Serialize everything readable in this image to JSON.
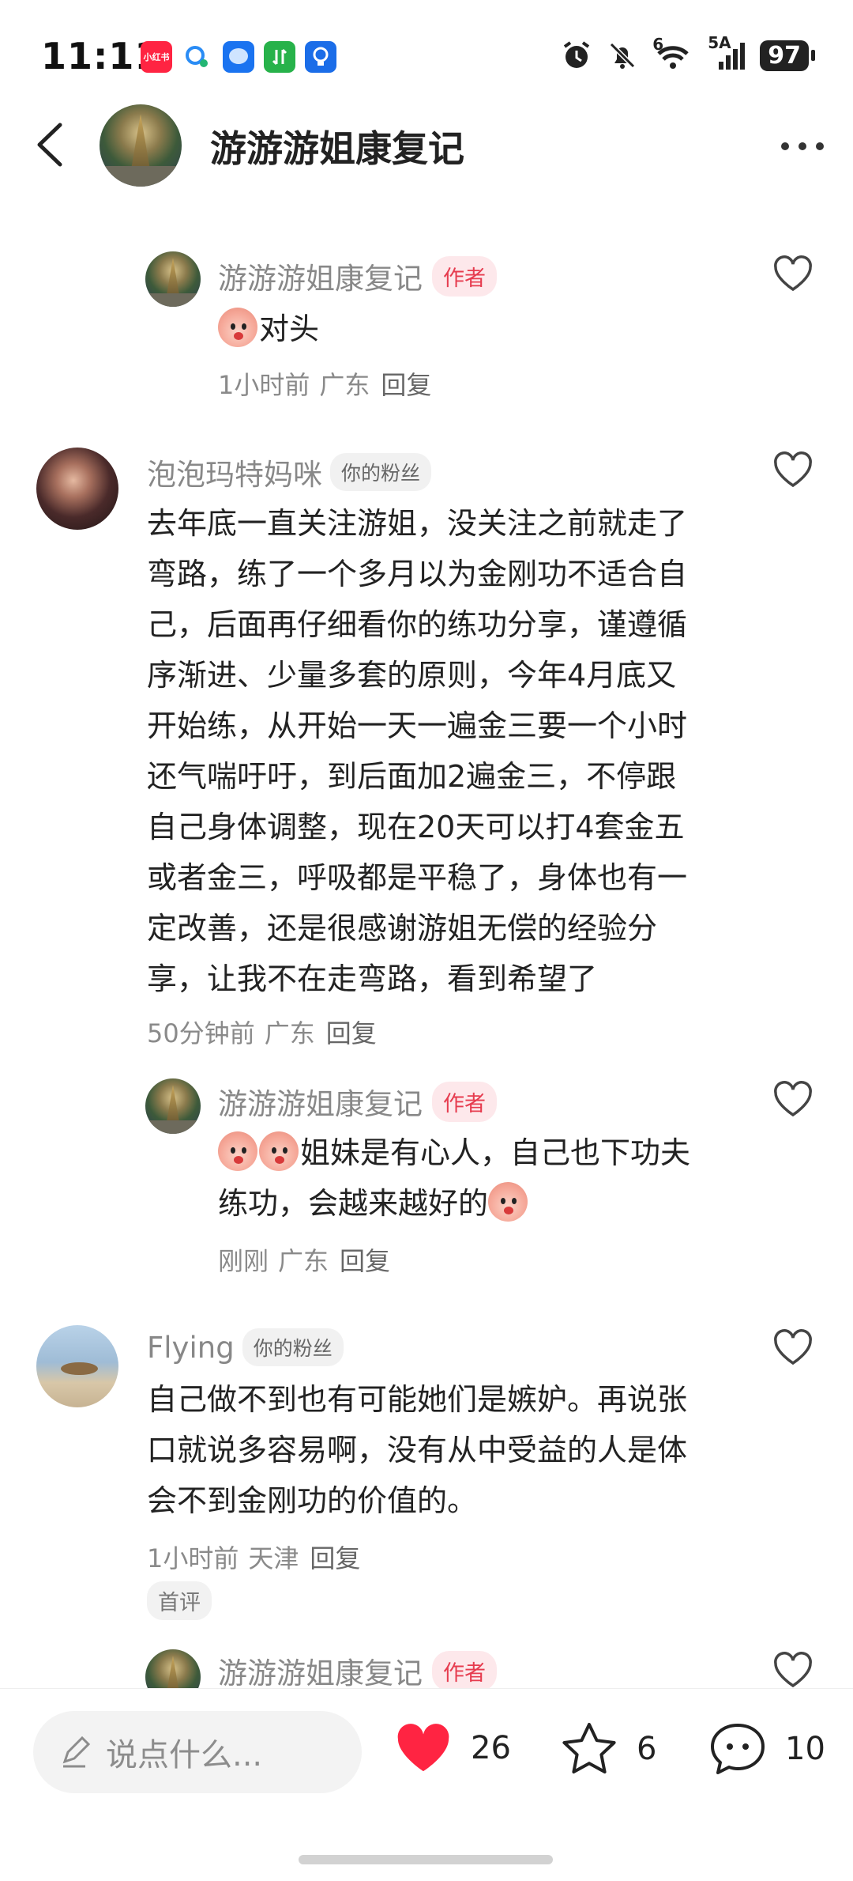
{
  "status_bar": {
    "time": "11:11",
    "app_badge_label": "小红书",
    "network_label": "5A",
    "wifi_label": "6",
    "battery": "97"
  },
  "header": {
    "title": "游游游姐康复记"
  },
  "comments": [
    {
      "name": "游游游姐康复记",
      "tag": "作者",
      "content": "对头",
      "time": "1小时前",
      "location": "广东",
      "reply": "回复"
    },
    {
      "name": "泡泡玛特妈咪",
      "tag": "你的粉丝",
      "lines": [
        "去年底一直关注游姐，没关注之前就走了",
        "弯路，练了一个多月以为金刚功不适合自",
        "己，后面再仔细看你的练功分享，谨遵循",
        "序渐进、少量多套的原则，今年4月底又",
        "开始练，从开始一天一遍金三要一个小时",
        "还气喘吁吁，到后面加2遍金三，不停跟",
        "自己身体调整，现在20天可以打4套金五",
        "或者金三，呼吸都是平稳了，身体也有一",
        "定改善，还是很感谢游姐无偿的经验分",
        "享，让我不在走弯路，看到希望了"
      ],
      "time": "50分钟前",
      "location": "广东",
      "reply": "回复"
    },
    {
      "name": "游游游姐康复记",
      "tag": "作者",
      "line1": "姐妹是有心人，自己也下功夫",
      "line2": "练功，会越来越好的",
      "time": "刚刚",
      "location": "广东",
      "reply": "回复"
    },
    {
      "name": "Flying",
      "tag": "你的粉丝",
      "lines": [
        "自己做不到也有可能她们是嫉妒。再说张",
        "口就说多容易啊，没有从中受益的人是体",
        "会不到金刚功的价值的。"
      ],
      "time": "1小时前",
      "location": "天津",
      "reply": "回复",
      "badge": "首评"
    },
    {
      "name": "游游游姐康复记",
      "tag": "作者"
    }
  ],
  "bottom_bar": {
    "input_placeholder": "说点什么...",
    "likes": "26",
    "collects": "6",
    "comments": "10"
  },
  "colors": {
    "accent_red": "#ff2442",
    "author_tag_bg": "#fde8eb"
  }
}
